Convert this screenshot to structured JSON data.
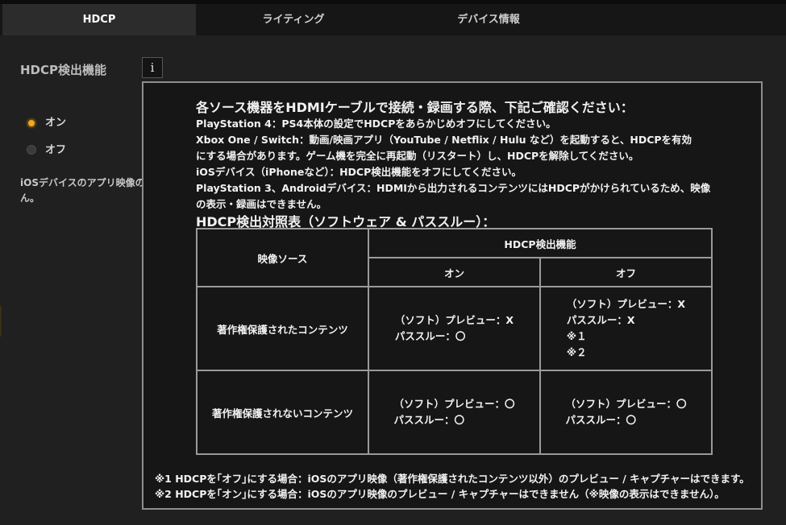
{
  "tabs": [
    {
      "label": "HDCP",
      "active": true
    },
    {
      "label": "ライティング",
      "active": false
    },
    {
      "label": "デバイス情報",
      "active": false
    }
  ],
  "settings": {
    "title": "HDCP検出機能",
    "info_glyph": "i",
    "options": [
      {
        "label": "オン",
        "selected": true
      },
      {
        "label": "オフ",
        "selected": false
      }
    ],
    "ios_note_line1": "iOSデバイスのアプリ映像の",
    "ios_note_line2": "ん。"
  },
  "popup": {
    "heading": "各ソース機器をHDMIケーブルで接続・録画する際、下記ご確認ください：",
    "lines": [
      "PlayStation 4：PS4本体の設定でHDCPをあらかじめオフにしてください。",
      "Xbox One / Switch：動画/映画アプリ（YouTube / Netflix / Hulu など）を起動すると、HDCPを有効",
      "にする場合があります。ゲーム機を完全に再起動（リスタート）し、HDCPを解除してください。",
      "iOSデバイス（iPhoneなど）：HDCP検出機能をオフにしてください。",
      "PlayStation 3、Androidデバイス：HDMIから出力されるコンテンツにはHDCPがかけられているため、映像",
      "の表示・録画はできません。"
    ],
    "table_title": "HDCP検出対照表（ソフトウェア & パススルー）：",
    "table": {
      "source_header": "映像ソース",
      "hdcp_header": "HDCP検出機能",
      "on_header": "オン",
      "off_header": "オフ",
      "rows": [
        {
          "label": "著作権保護されたコンテンツ",
          "on": [
            "（ソフト）プレビュー：X",
            "パススルー：〇"
          ],
          "off": [
            "（ソフト）プレビュー：X",
            "パススルー：X",
            "※１",
            "※２"
          ]
        },
        {
          "label": "著作権保護されないコンテンツ",
          "on": [
            "（ソフト）プレビュー：〇",
            "パススルー：〇"
          ],
          "off": [
            "（ソフト）プレビュー：〇",
            "パススルー：〇"
          ]
        }
      ]
    },
    "footnotes": [
      "※1 HDCPを｢オフ｣にする場合：iOSのアプリ映像（著作権保護されたコンテンツ以外）のプレビュー / キャプチャーはできます。",
      "※2 HDCPを｢オン｣にする場合：iOSのアプリ映像のプレビュー / キャプチャーはできません（※映像の表示はできません）。"
    ]
  }
}
